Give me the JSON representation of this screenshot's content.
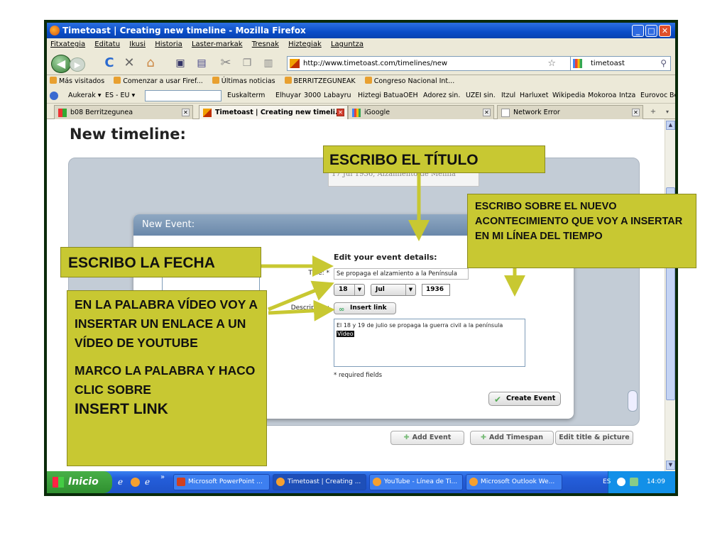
{
  "window": {
    "title": "Timetoast | Creating new timeline - Mozilla Firefox",
    "controls": {
      "minimize": "_",
      "maximize": "□",
      "close": "✕"
    }
  },
  "menu": [
    "Fitxategia",
    "Editatu",
    "Ikusi",
    "Historia",
    "Laster-markak",
    "Tresnak",
    "Hiztegiak",
    "Laguntza"
  ],
  "nav": {
    "url": "http://www.timetoast.com/timelines/new",
    "search_value": "timetoast",
    "back_icon": "◀",
    "forward_icon": "▶",
    "reload_icon": "C",
    "stop_icon": "✕",
    "home_icon": "⌂",
    "star_icon": "☆",
    "search_icon": "⚲"
  },
  "bookmarks": [
    "Más visitados",
    "Comenzar a usar Firef...",
    "Últimas noticias",
    "BERRITZEGUNEAK",
    "Congreso Nacional Int..."
  ],
  "toolbar": {
    "aukerak": "Aukerak ▾",
    "lang": "ES - EU ▾",
    "links": [
      "Euskalterm",
      "Elhuyar",
      "3000",
      "Labayru",
      "Hiztegi Batua",
      "OEH",
      "Adorez sin.",
      "UZEI sin.",
      "Itzul",
      "Harluxet",
      "Wikipedia",
      "Mokoroa",
      "Intza",
      "Eurovoc",
      "Be"
    ]
  },
  "tabs": [
    {
      "label": "b08 Berritzegunea",
      "active": false
    },
    {
      "label": "Timetoast | Creating new timeli...",
      "active": true
    },
    {
      "label": "iGoogle",
      "active": false
    },
    {
      "label": "Network Error",
      "active": false
    }
  ],
  "page": {
    "title": "New timeline:",
    "event_strip": "17 Jul 1936, Alzamiento de Melilla",
    "modal_title": "New Event:",
    "form_heading": "Edit your event details:",
    "title_label": "Title: *",
    "title_value": "Se propaga el alzamiento a la Península",
    "day": "18",
    "month": "Jul",
    "year": "1936",
    "description_label": "Description:",
    "insert_link": "Insert link",
    "description_text": "El 18 y 19 de julio se propaga la guerra civil a la península",
    "description_selected": "Vídeo",
    "required_note": "* required fields",
    "create_button": "Create Event",
    "add_event": "Add Event",
    "add_timespan": "Add Timespan",
    "edit_title": "Edit title & picture"
  },
  "taskbar": {
    "start": "Inicio",
    "tasks": [
      {
        "label": "Microsoft PowerPoint ...",
        "active": false
      },
      {
        "label": "Timetoast | Creating ...",
        "active": true
      },
      {
        "label": "YouTube - Línea de Ti...",
        "active": false
      },
      {
        "label": "Microsoft Outlook We...",
        "active": false
      }
    ],
    "lang": "ES",
    "clock": "14:09"
  },
  "annotations": {
    "titulo": "ESCRIBO EL TÍTULO",
    "fecha": "ESCRIBO LA FECHA",
    "acontecimiento": "ESCRIBO SOBRE EL NUEVO ACONTECIMIENTO QUE VOY A INSERTAR EN MI LÍNEA DEL TIEMPO",
    "video": "EN LA PALABRA VÍDEO VOY A INSERTAR UN ENLACE A UN VÍDEO DE YOUTUBE",
    "marco": "MARCO LA PALABRA Y HACO CLIC SOBRE",
    "insert_link": "INSERT LINK"
  },
  "colors": {
    "annotation_bg": "#c8c832",
    "titlebar": "#0a4dc8",
    "taskbar": "#245edb"
  }
}
